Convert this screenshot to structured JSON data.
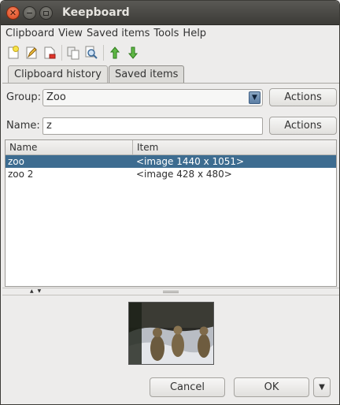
{
  "window": {
    "title": "Keepboard"
  },
  "menubar": [
    "Clipboard",
    "View",
    "Saved items",
    "Tools",
    "Help"
  ],
  "toolbar": {
    "icons": [
      "new-item-icon",
      "edit-icon",
      "delete-icon",
      "copy-icon",
      "search-icon",
      "move-up-icon",
      "move-down-icon"
    ]
  },
  "tabs": [
    {
      "label": "Clipboard history",
      "active": false
    },
    {
      "label": "Saved items",
      "active": true
    }
  ],
  "group": {
    "label": "Group:",
    "value": "Zoo",
    "actions_label": "Actions"
  },
  "name": {
    "label": "Name:",
    "value": "z",
    "actions_label": "Actions"
  },
  "table": {
    "columns": [
      "Name",
      "Item"
    ],
    "rows": [
      {
        "name": "zoo",
        "item": "<image 1440 x 1051>",
        "selected": true
      },
      {
        "name": "zoo 2",
        "item": "<image 428 x 480>",
        "selected": false
      }
    ]
  },
  "buttons": {
    "cancel": "Cancel",
    "ok": "OK"
  },
  "colors": {
    "selection": "#3d6c90",
    "close_button": "#e8552a",
    "titlebar": "#3c3b37"
  }
}
